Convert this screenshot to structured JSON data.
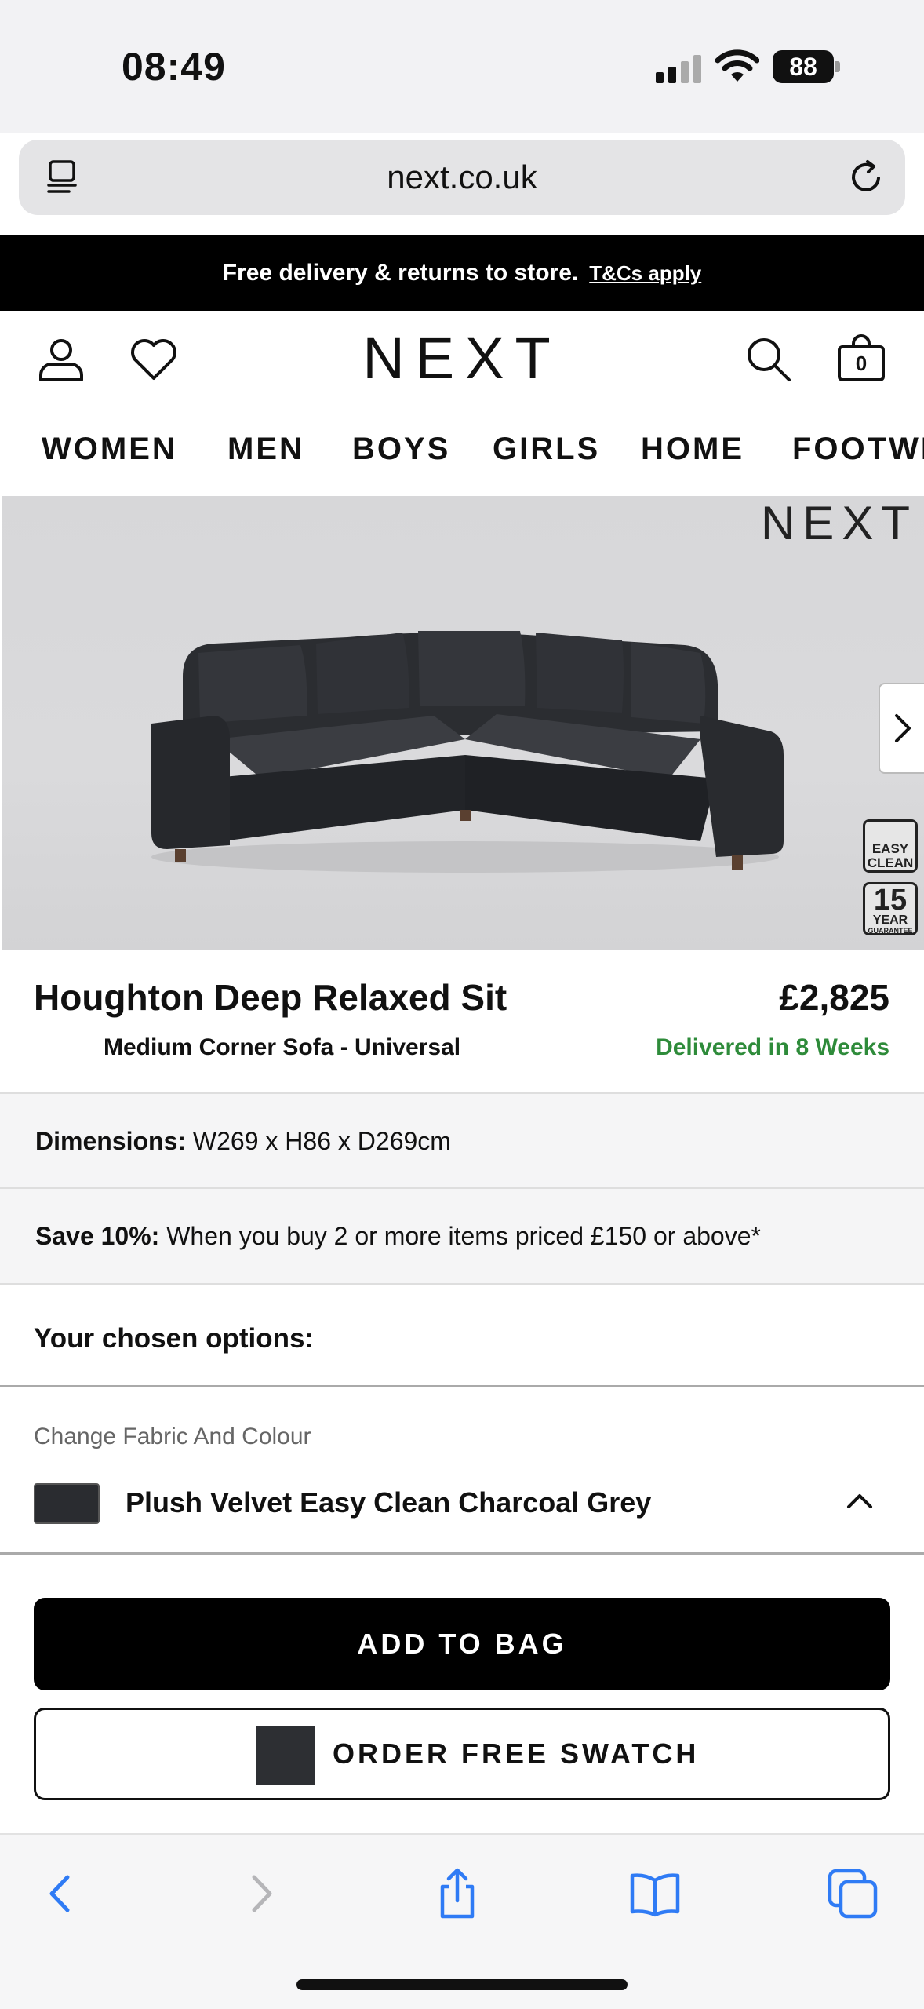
{
  "status_bar": {
    "time": "08:49",
    "battery": "88"
  },
  "browser": {
    "url": "next.co.uk"
  },
  "promo": {
    "text": "Free delivery & returns to store.",
    "link": "T&Cs apply"
  },
  "header": {
    "logo": "NEXT",
    "bag_count": "0"
  },
  "categories": [
    "WOMEN",
    "MEN",
    "BOYS",
    "GIRLS",
    "HOME",
    "FOOTWEAR"
  ],
  "hero": {
    "brand": "NEXT",
    "badge_easy_clean": "EASY CLEAN",
    "badge_years": "15",
    "badge_year_label": "YEAR",
    "badge_guarantee": "GUARANTEE"
  },
  "product": {
    "title": "Houghton Deep Relaxed Sit",
    "subtitle": "Medium Corner Sofa - Universal",
    "price": "£2,825",
    "delivery": "Delivered in 8 Weeks"
  },
  "info": {
    "dimensions_label": "Dimensions:",
    "dimensions_value": " W269 x H86 x D269cm",
    "save_label": "Save 10%:",
    "save_value": " When you buy 2 or more items priced £150 or above*"
  },
  "options": {
    "title": "Your chosen options:",
    "fabric_label": "Change Fabric And Colour",
    "fabric_value": "Plush Velvet Easy Clean Charcoal Grey"
  },
  "buttons": {
    "add_to_bag": "ADD TO BAG",
    "order_swatch": "ORDER FREE SWATCH"
  },
  "colors": {
    "accent_green": "#2e8b3a",
    "ios_blue": "#2f7bf5",
    "swatch": "#2d2f33"
  }
}
